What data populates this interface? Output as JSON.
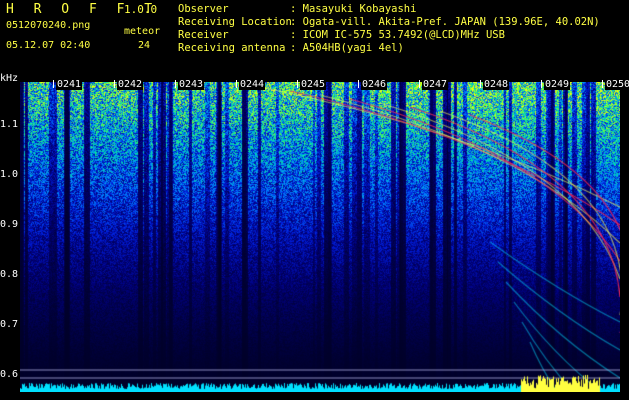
{
  "header": {
    "app_title": "H R O F F T",
    "app_version": "1.0.0",
    "file_name": "0512070240.png",
    "meteor_label": "meteor",
    "datetime": "05.12.07 02:40",
    "meteor_count": "24"
  },
  "info": [
    {
      "key": "Observer",
      "value": ": Masayuki Kobayashi"
    },
    {
      "key": "Receiving Location",
      "value": ": Ogata-vill. Akita-Pref. JAPAN (139.96E, 40.02N)"
    },
    {
      "key": "Receiver",
      "value": ": ICOM IC-575 53.7492(@LCD)MHz USB"
    },
    {
      "key": "Receiving antenna",
      "value": ": A504HB(yagi 4el)"
    }
  ],
  "axis": {
    "unit": "kHz",
    "freq_ticks": [
      "1.1",
      "1.0",
      "0.9",
      "0.8",
      "0.7",
      "0.6"
    ],
    "time_ticks": [
      "0241",
      "0242",
      "0243",
      "0244",
      "0245",
      "0246",
      "0247",
      "0248",
      "0249",
      "0250"
    ]
  },
  "colors": {
    "header_text": "#ffff44",
    "background": "#000000",
    "waterfall_low": "#000040",
    "waterfall_mid": "#0000ff",
    "waterfall_high": "#00ff80",
    "meteor_echo": "#ff2050",
    "baseline": "#00ffff"
  }
}
